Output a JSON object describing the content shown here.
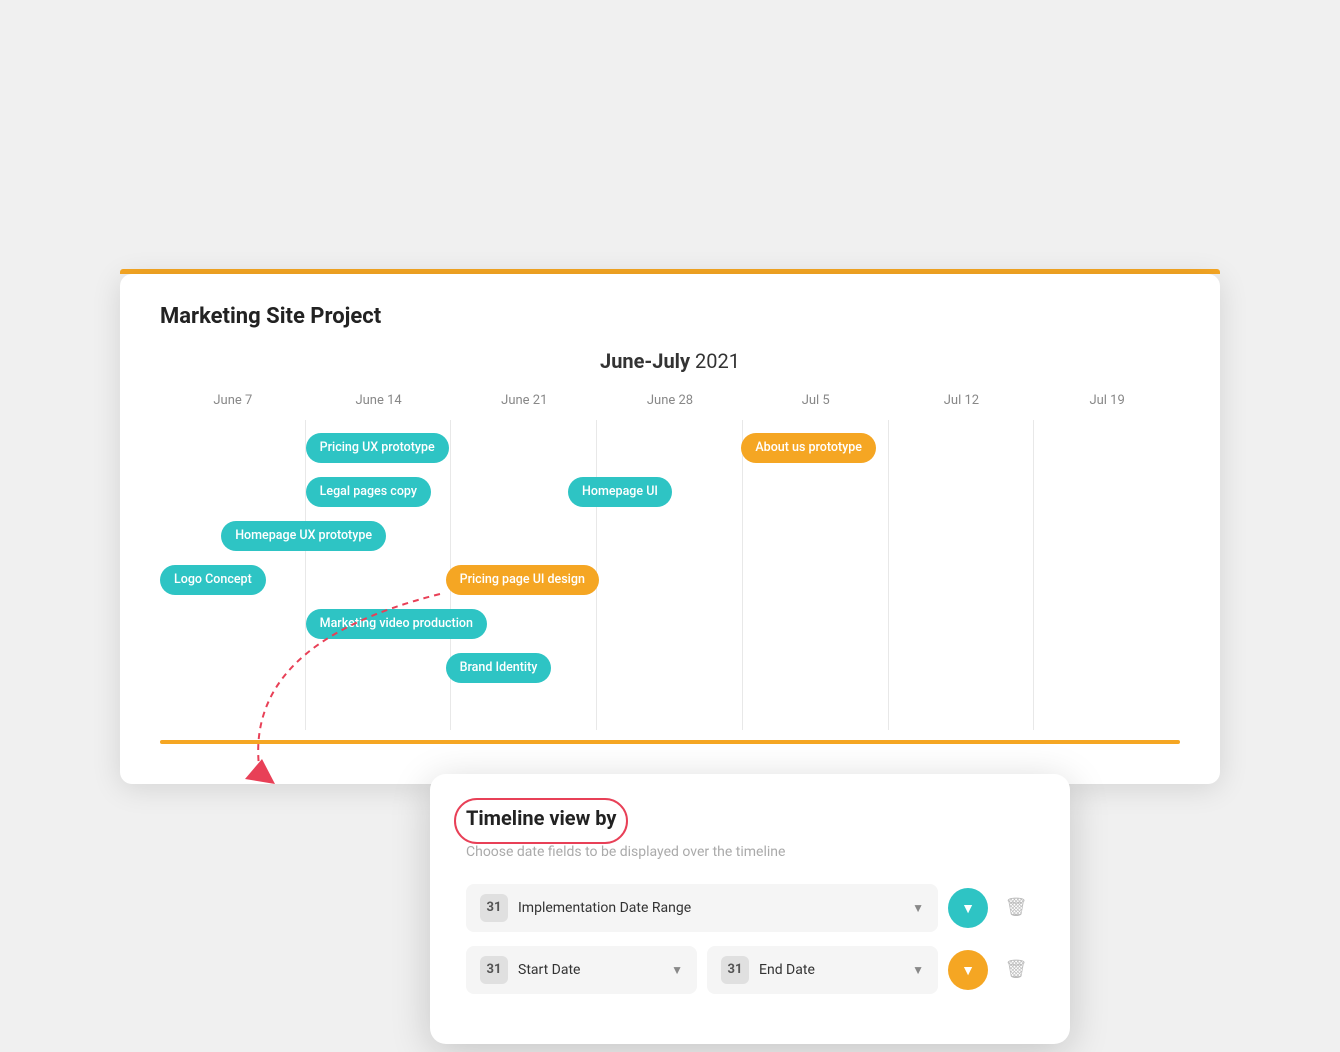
{
  "project": {
    "title": "Marketing Site Project",
    "chart_title_bold": "June-July",
    "chart_title_year": " 2021"
  },
  "columns": [
    "June 7",
    "June 14",
    "June 21",
    "June 28",
    "Jul 5",
    "Jul 12",
    "Jul 19"
  ],
  "tasks": [
    {
      "label": "Pricing UX prototype",
      "color": "teal",
      "left_pct": 14.28,
      "width_pct": 27
    },
    {
      "label": "About us prototype",
      "color": "orange",
      "left_pct": 57,
      "width_pct": 40
    },
    {
      "label": "Legal pages copy",
      "color": "teal",
      "left_pct": 14.28,
      "width_pct": 20
    },
    {
      "label": "Homepage UI",
      "color": "teal",
      "left_pct": 42,
      "width_pct": 55
    },
    {
      "label": "Homepage UX prototype",
      "color": "teal",
      "left_pct": 7,
      "width_pct": 40
    },
    {
      "label": "Logo Concept",
      "color": "teal",
      "left_pct": 0,
      "width_pct": 16
    },
    {
      "label": "Pricing page UI design",
      "color": "orange",
      "left_pct": 28.5,
      "width_pct": 36
    },
    {
      "label": "Marketing video production",
      "color": "teal",
      "left_pct": 14.28,
      "width_pct": 55
    },
    {
      "label": "Brand Identity",
      "color": "teal",
      "left_pct": 28.5,
      "width_pct": 27
    }
  ],
  "popup": {
    "title": "Timeline view by",
    "subtitle": "Choose date fields to be displayed over the timeline",
    "rows": [
      {
        "fields": [
          {
            "label": "Implementation Date Range",
            "icon": "31"
          }
        ],
        "button_color": "teal",
        "show_trash": true
      },
      {
        "fields": [
          {
            "label": "Start Date",
            "icon": "31"
          },
          {
            "label": "End Date",
            "icon": "31"
          }
        ],
        "button_color": "orange",
        "show_trash": true
      }
    ]
  },
  "colors": {
    "teal": "#2EC4C4",
    "orange": "#F5A623",
    "red": "#e84057"
  }
}
